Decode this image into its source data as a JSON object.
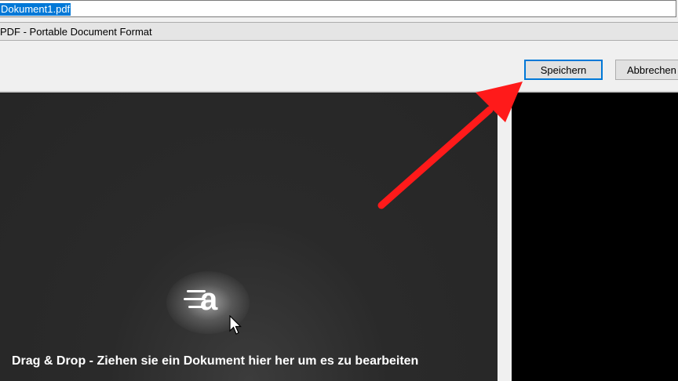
{
  "dialog": {
    "filename_value": "Dokument1.pdf",
    "filetype_value": "PDF - Portable Document Format",
    "save_label": "Speichern",
    "cancel_label": "Abbrechen"
  },
  "dropzone": {
    "caption": "Drag & Drop - Ziehen sie ein Dokument hier her um es zu bearbeiten",
    "logo_letter": "a",
    "logo_icon": "app-logo-icon"
  },
  "annotation": {
    "arrow_color": "#ff1a1a",
    "arrow_target": "save-button"
  },
  "colors": {
    "selection": "#0078d7",
    "dropzone_bg": "#2a2a2a",
    "button_focus": "#0078d7"
  }
}
